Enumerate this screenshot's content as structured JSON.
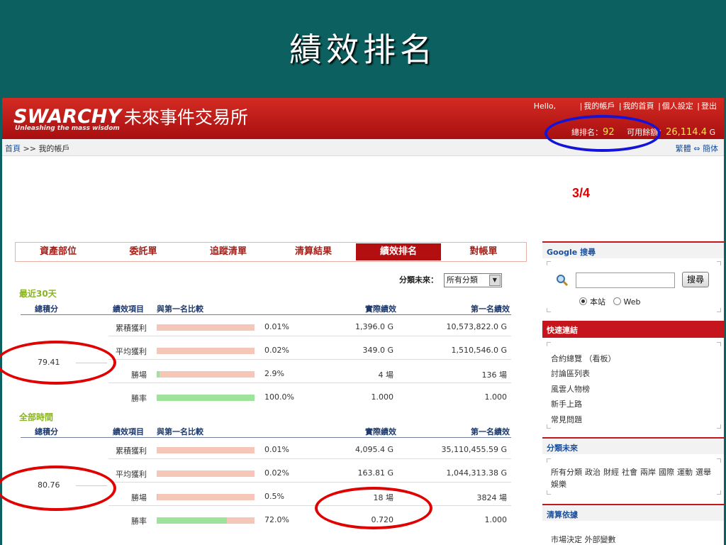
{
  "slide": {
    "title": "績效排名",
    "page_num": "3/4"
  },
  "header": {
    "brand": "SWARCHY",
    "site_name": "未來事件交易所",
    "tagline": "Unleashing the mass wisdom",
    "hello": "Hello,",
    "links": [
      "我的帳戶",
      "我的首頁",
      "個人設定",
      "登出"
    ],
    "rank_label": "總排名：",
    "rank_value": "92",
    "balance_label": "可用餘額：",
    "balance_value": "26,114.4",
    "balance_unit": "G"
  },
  "breadcrumb": {
    "home": "首頁",
    "sep": ">>",
    "current": "我的帳戶"
  },
  "lang": {
    "trad": "繁體",
    "arrow": "⇔",
    "simp": "簡体"
  },
  "tabs": [
    "資產部位",
    "委託單",
    "追蹤清單",
    "清算結果",
    "績效排名",
    "對帳單"
  ],
  "active_tab": 4,
  "filter": {
    "label": "分類未來：",
    "value": "所有分類"
  },
  "columns": {
    "total": "總積分",
    "item": "績效項目",
    "compare": "與第一名比較",
    "actual": "實際績效",
    "top": "第一名績效"
  },
  "periods": [
    {
      "label": "最近30天",
      "total": "79.41",
      "rows": [
        {
          "item": "累積獲利",
          "pct": "0.01%",
          "ratio": 0.0,
          "actual": "1,396.0 G",
          "top": "10,573,822.0 G"
        },
        {
          "item": "平均獲利",
          "pct": "0.02%",
          "ratio": 0.0,
          "actual": "349.0 G",
          "top": "1,510,546.0 G"
        },
        {
          "item": "勝場",
          "pct": "2.9%",
          "ratio": 0.029,
          "actual": "4 場",
          "top": "136 場"
        },
        {
          "item": "勝率",
          "pct": "100.0%",
          "ratio": 1.0,
          "actual": "1.000",
          "top": "1.000"
        }
      ]
    },
    {
      "label": "全部時間",
      "total": "80.76",
      "rows": [
        {
          "item": "累積獲利",
          "pct": "0.01%",
          "ratio": 0.0,
          "actual": "4,095.4 G",
          "top": "35,110,455.59 G"
        },
        {
          "item": "平均獲利",
          "pct": "0.02%",
          "ratio": 0.0,
          "actual": "163.81 G",
          "top": "1,044,313.38 G"
        },
        {
          "item": "勝場",
          "pct": "0.5%",
          "ratio": 0.005,
          "actual": "18 場",
          "top": "3824 場"
        },
        {
          "item": "勝率",
          "pct": "72.0%",
          "ratio": 0.72,
          "actual": "0.720",
          "top": "1.000"
        }
      ]
    }
  ],
  "sidebar": {
    "google_head": "Google 搜尋",
    "search_button": "搜尋",
    "radio_site": "本站",
    "radio_web": "Web",
    "quick_head": "快速連結",
    "quick_links": [
      "合約總覽 （看板）",
      "討論區列表",
      "風雲人物榜",
      "新手上路",
      "常見問題"
    ],
    "cat_head": "分類未來",
    "cat_links": [
      "所有分類",
      "政治",
      "財經",
      "社會",
      "兩岸",
      "國際",
      "運動",
      "選舉",
      "娛樂"
    ],
    "settle_head": "清算依據",
    "settle_links": [
      "市場決定",
      "外部變數"
    ]
  },
  "colors": {
    "header_red": "#c4161c",
    "annotation_blue": "#1414d8",
    "annotation_red": "#e00000",
    "bar_bg": "#f6c7b8",
    "bar_fill": "#9ee39a"
  }
}
